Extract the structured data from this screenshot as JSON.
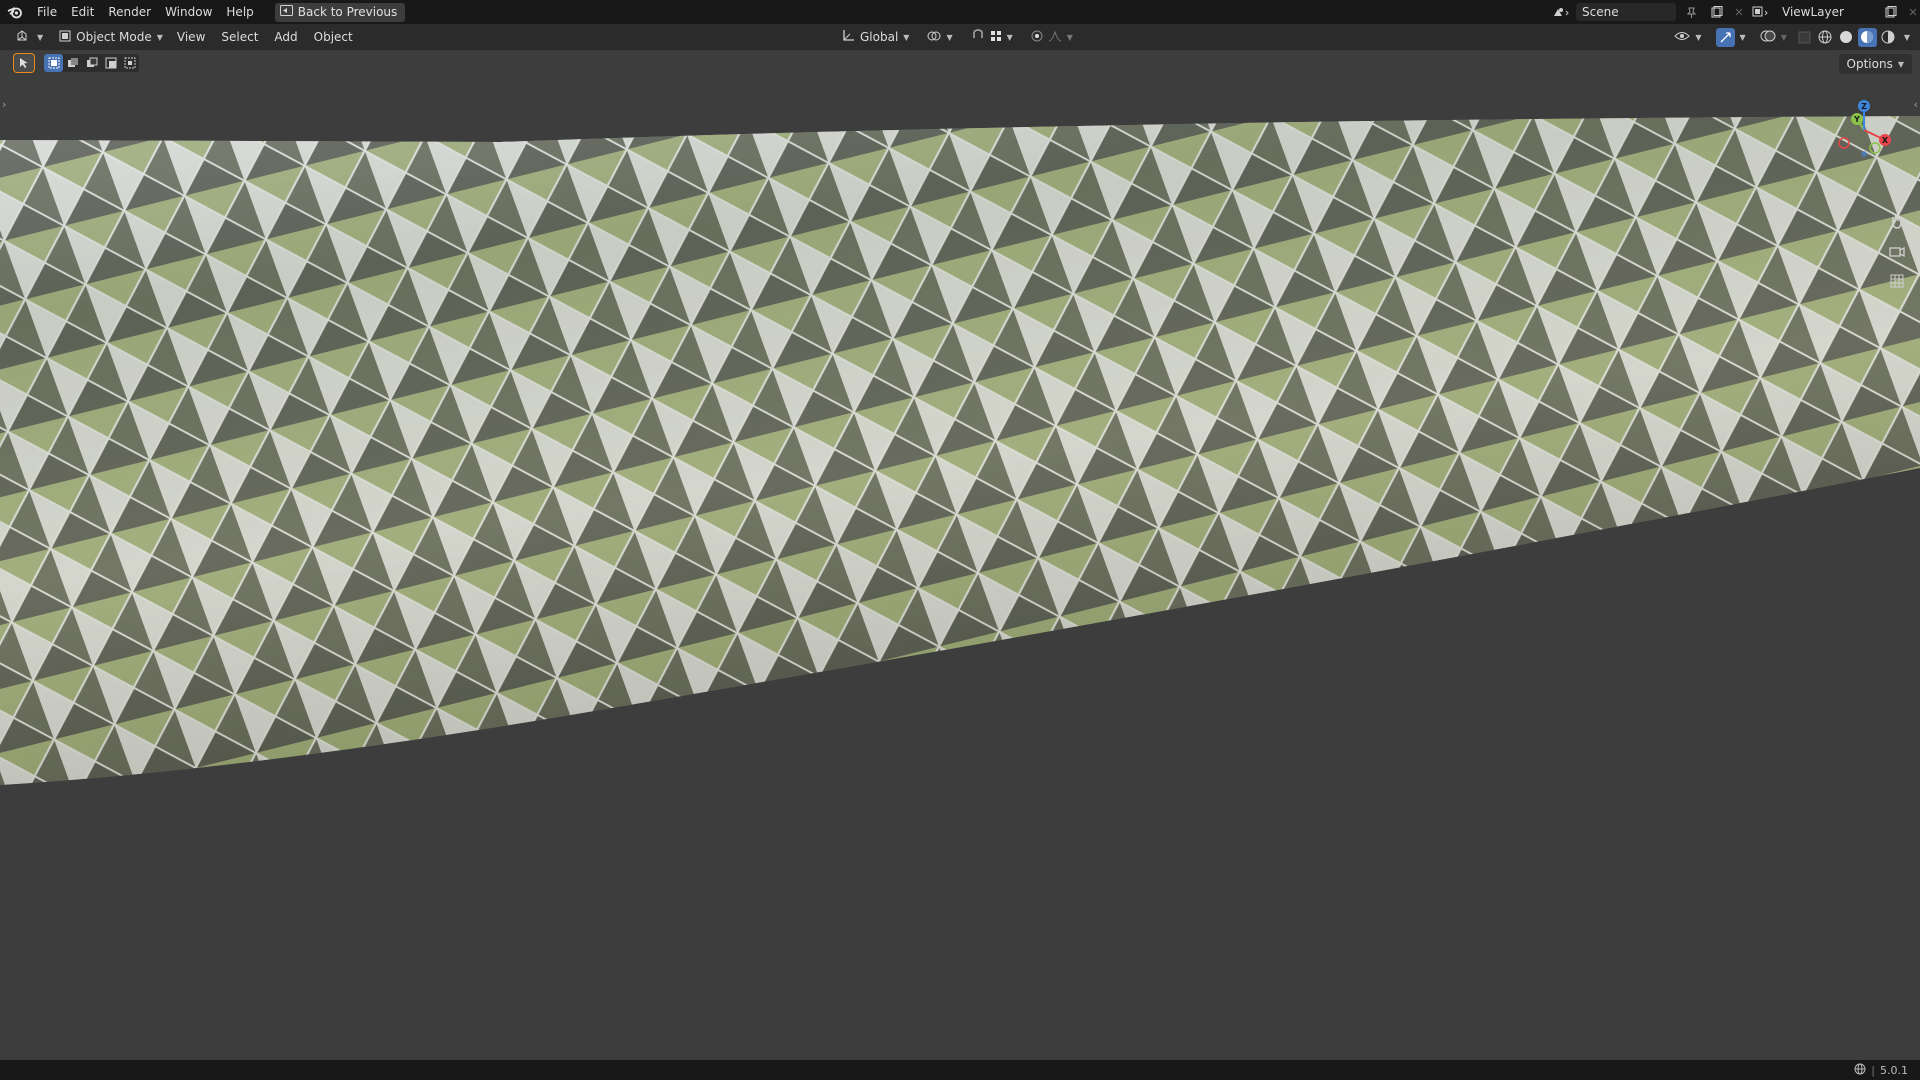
{
  "topbar": {
    "menus": [
      "File",
      "Edit",
      "Render",
      "Window",
      "Help"
    ],
    "back_button": "Back to Previous",
    "scene_name": "Scene",
    "view_layer": "ViewLayer"
  },
  "header": {
    "mode": "Object Mode",
    "menus": [
      "View",
      "Select",
      "Add",
      "Object"
    ],
    "transform_orientation": "Global"
  },
  "viewport": {
    "options_label": "Options",
    "gizmo_axes": {
      "x": "X",
      "y": "Y",
      "z": "Z"
    },
    "colors": {
      "x_axis": "#e5454b",
      "y_axis": "#8bc34a",
      "z_axis": "#3d86e0",
      "accent": "#4772b3",
      "active_outline": "#e88a14"
    }
  },
  "icons": [
    "blender-logo-icon",
    "back-icon",
    "editor-type-icon",
    "object-mode-icon",
    "transform-icon",
    "snap-icon",
    "proportional-icon",
    "overlay-icon",
    "xray-icon",
    "wireframe-icon",
    "solid-icon",
    "material-icon",
    "rendered-icon",
    "zoom-icon",
    "hand-icon",
    "camera-icon",
    "grid-icon",
    "globe-icon"
  ],
  "statusbar": {
    "version": "5.0.1"
  }
}
